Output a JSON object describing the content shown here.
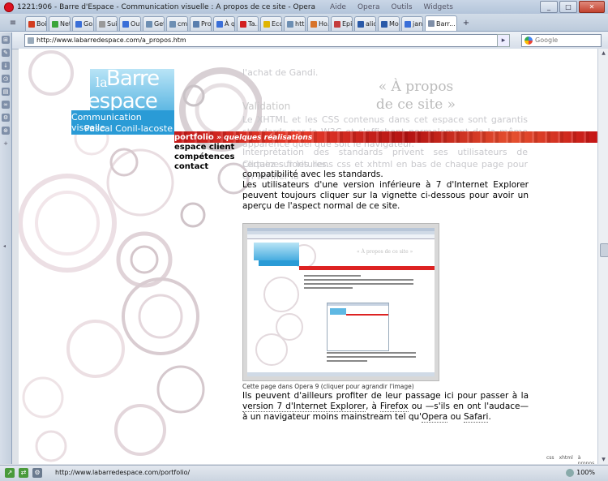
{
  "window": {
    "title": "1221:906 - Barre d'Espace - Communication visuelle : A propos de ce site - Opera",
    "menu": [
      "Aide",
      "Opera",
      "Outils",
      "Widgets"
    ],
    "minimize": "_",
    "maximize": "□",
    "close": "✕"
  },
  "tabs": {
    "menu_icon": "≡",
    "items": [
      {
        "label": "Boi...",
        "icon_color": "#d23c1f"
      },
      {
        "label": "Net...",
        "icon_color": "#3aa53a"
      },
      {
        "label": "Go...",
        "icon_color": "#3a6fd8"
      },
      {
        "label": "Sui...",
        "icon_color": "#9a9a9a"
      },
      {
        "label": "Out...",
        "icon_color": "#3a6fd8"
      },
      {
        "label": "Get...",
        "icon_color": "#6d8fb3"
      },
      {
        "label": "cm...",
        "icon_color": "#6d8fb3"
      },
      {
        "label": "Pro...",
        "icon_color": "#5a7fae"
      },
      {
        "label": "À q...",
        "icon_color": "#3a6fd8"
      },
      {
        "label": "Ta...",
        "icon_color": "#d21f1f"
      },
      {
        "label": "Eco...",
        "icon_color": "#e0b400"
      },
      {
        "label": "htt...",
        "icon_color": "#6d8fb3"
      },
      {
        "label": "Ho...",
        "icon_color": "#d8742a"
      },
      {
        "label": "Epi...",
        "icon_color": "#c43c3c"
      },
      {
        "label": "alic...",
        "icon_color": "#2a5aa8"
      },
      {
        "label": "Mo...",
        "icon_color": "#2a5aa8"
      },
      {
        "label": "jan...",
        "icon_color": "#3a6fd8"
      },
      {
        "label": "Barr...",
        "icon_color": "#7f8fa8"
      }
    ],
    "new_tab": "+"
  },
  "address": {
    "back": "◂",
    "url": "http://www.labarredespace.com/a_propos.htm",
    "go_icon": "▸",
    "search_engine": "Google",
    "search_placeholder": "Google"
  },
  "panel_icons": [
    "⊞",
    "✎",
    "↓",
    "◷",
    "▤",
    "∞",
    "⚙",
    "⊛",
    "+"
  ],
  "page": {
    "logo": {
      "la": "la",
      "barre": "Barre",
      "espace": "d'espace",
      "tagline1": "Communication visuelle",
      "tagline2": "Pascal Conil-lacoste"
    },
    "nav": [
      {
        "label": "portfolio",
        "sub": "» quelques réalisations"
      },
      {
        "label": "espace client",
        "sub": ""
      },
      {
        "label": "compétences",
        "sub": ""
      },
      {
        "label": "contact",
        "sub": ""
      }
    ],
    "faded_lines": {
      "top": "l'achat de Gandi.",
      "heading_line1": "« À propos",
      "heading_line2": "de ce site »",
      "validation": "Validation",
      "p1": "Le XHTML et les CSS contenus dans cet espace sont garantis standards par le W3C et s'affichent normalement de la même apparence quel que soit le navigateur.",
      "p2": "Interprétation des standards privent ses utilisateurs de certaines fioritures.",
      "p3": "Cliquez sur les liens css et xhtml en bas de chaque page pour en vérifier la"
    },
    "content": {
      "p1_tail": "compatibilité avec les standards.",
      "p2": "Les utilisateurs d'une version inférieure à 7 d'Internet Explorer peuvent toujours cliquer sur la vignette ci-dessous pour avoir un aperçu de l'aspect normal de ce site."
    },
    "screenshot_thumb": {
      "heading": "« À propos de ce site »"
    },
    "caption": "Cette page dans Opera 9 (cliquer pour agrandir l'image)",
    "content2": {
      "before": "Ils peuvent d'ailleurs profiter de leur passage ici pour passer à la ",
      "link1": "version 7 d'Internet Explorer",
      "mid1": ", à ",
      "link2": "Firefox",
      "mid2": " ou —s'ils en ont l'audace— à un navigateur moins mainstream tel qu'",
      "link3": "Opera",
      "mid3": " ou ",
      "link4": "Safari",
      "after": "."
    },
    "footer_links": [
      "css",
      "xhtml",
      "à propos"
    ]
  },
  "status": {
    "url": "http://www.labarredespace.com/portfolio/",
    "zoom": "100%"
  },
  "colors": {
    "accent_blue": "#2a9bd6",
    "banner_red": "#d22a1f",
    "chrome": "#c9d6e6"
  }
}
